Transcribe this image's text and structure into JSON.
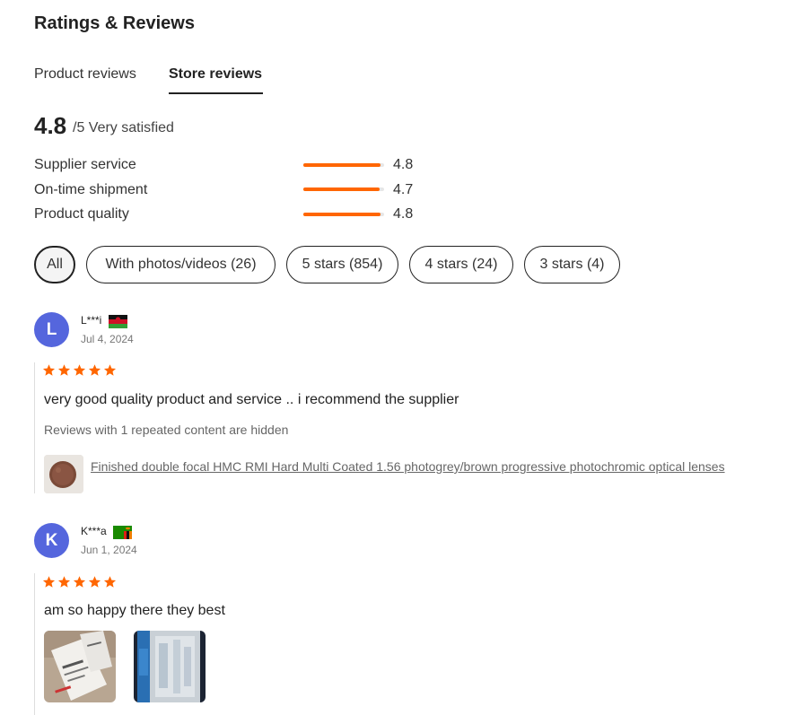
{
  "header": {
    "title": "Ratings & Reviews"
  },
  "tabs": [
    {
      "label": "Product reviews",
      "active": false
    },
    {
      "label": "Store reviews",
      "active": true
    }
  ],
  "summary": {
    "score": "4.8",
    "suffix": "/5 Very satisfied"
  },
  "metrics": [
    {
      "label": "Supplier service",
      "value": "4.8",
      "fraction": 0.96
    },
    {
      "label": "On-time shipment",
      "value": "4.7",
      "fraction": 0.94
    },
    {
      "label": "Product quality",
      "value": "4.8",
      "fraction": 0.96
    }
  ],
  "filters": [
    {
      "label": "All",
      "active": true
    },
    {
      "label": "With photos/videos (26)",
      "active": false
    },
    {
      "label": "5 stars (854)",
      "active": false
    },
    {
      "label": "4 stars (24)",
      "active": false
    },
    {
      "label": "3 stars (4)",
      "active": false
    }
  ],
  "colors": {
    "accent": "#ff6600",
    "avatar": "#5566dd"
  },
  "reviews": [
    {
      "initial": "L",
      "name": "L***i",
      "flag": "malawi-flag-icon",
      "date": "Jul 4, 2024",
      "rating": 5,
      "text": "very good quality product and service .. i recommend the supplier",
      "hidden_note": "Reviews with 1 repeated content are hidden",
      "product_link": "Finished double focal HMC RMI Hard Multi Coated 1.56 photogrey/brown progressive photochromic optical lenses"
    },
    {
      "initial": "K",
      "name": "K***a",
      "flag": "zambia-flag-icon",
      "date": "Jun 1, 2024",
      "rating": 5,
      "text": "am so happy there they best"
    }
  ]
}
